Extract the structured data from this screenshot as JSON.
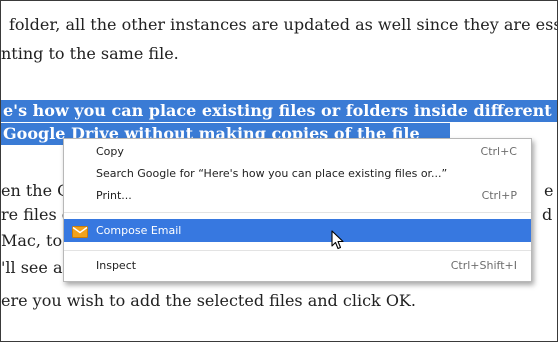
{
  "article": {
    "line1": "folder, all the other instances are updated as well since they are essentiall",
    "line2": "nting to the same file.",
    "selected_line1": "e's how you can place existing files or folders inside different multiple fold",
    "selected_line2": "Google Drive without making copies of the file",
    "line3": "en the G",
    "line3_tail": "e",
    "line4": "re files c",
    "line4_tail": "d",
    "line5": "Mac, to",
    "line6": "'ll see a",
    "line7": "ere you wish to add the selected files and click OK."
  },
  "context_menu": {
    "items": [
      {
        "label": "Copy",
        "shortcut": "Ctrl+C"
      },
      {
        "label": "Search Google for “Here's how you can place existing files or...”",
        "shortcut": ""
      },
      {
        "label": "Print...",
        "shortcut": "Ctrl+P"
      },
      {
        "label": "Compose Email",
        "shortcut": "",
        "icon": "envelope-icon",
        "highlighted": true
      },
      {
        "label": "Inspect",
        "shortcut": "Ctrl+Shift+I"
      }
    ]
  },
  "colors": {
    "selection": "#3a7bd5",
    "menu_highlight": "#3778e0",
    "envelope_orange": "#f2a21b"
  }
}
